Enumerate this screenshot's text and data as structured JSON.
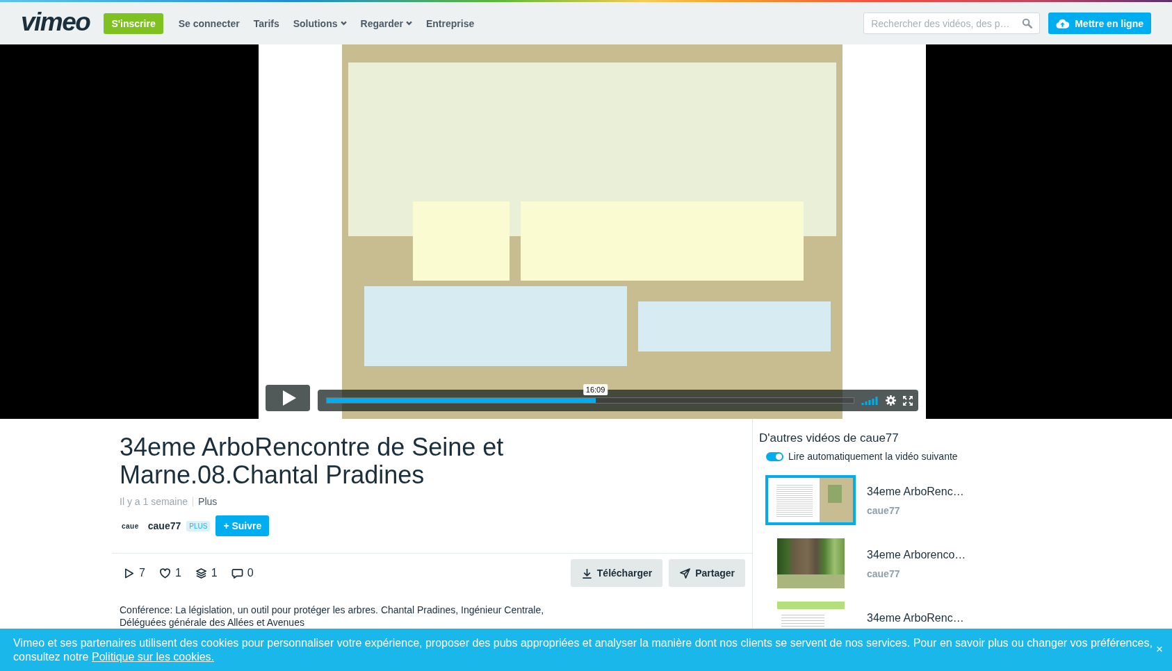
{
  "header": {
    "logo": "vimeo",
    "signup_button": "S'inscrire",
    "nav": [
      {
        "label": "Se connecter",
        "dropdown": false
      },
      {
        "label": "Tarifs",
        "dropdown": false
      },
      {
        "label": "Solutions",
        "dropdown": true
      },
      {
        "label": "Regarder",
        "dropdown": true
      },
      {
        "label": "Entreprise",
        "dropdown": false
      }
    ],
    "search": {
      "placeholder": "Rechercher des vidéos, des p…"
    },
    "upload_button": "Mettre en ligne"
  },
  "player": {
    "playing": false,
    "progress": {
      "level": 0.51
    },
    "time_tooltip": "16:09"
  },
  "video": {
    "title": "34eme ArboRencontre de Seine et Marne.08.Chantal Pradines",
    "age": "Il y a 1 semaine",
    "more_link": "Plus",
    "channel": {
      "logo": "caue",
      "name": "caue77",
      "badge": "PLUS",
      "follow_button": "+ Suivre"
    },
    "stats": [
      {
        "kind": "plays",
        "value": "7"
      },
      {
        "kind": "likes",
        "value": "1"
      },
      {
        "kind": "collections",
        "value": "1"
      },
      {
        "kind": "comments",
        "value": "0"
      }
    ],
    "actions": [
      {
        "kind": "download",
        "label": "Télécharger"
      },
      {
        "kind": "share",
        "label": "Partager"
      }
    ],
    "description": "Conférence: La législation, un outil pour protéger les arbres. Chantal Pradines, Ingénieur Centrale, Déléguées générale des Allées et Avenues"
  },
  "sidebar": {
    "heading": "D'autres vidéos de caue77",
    "autoplay": {
      "label": "Lire automatiquement la vidéo suivante",
      "on": true
    },
    "videos": [
      {
        "kind": "document",
        "title": "34eme ArboRenc…",
        "channel": "caue77",
        "selected": true
      },
      {
        "kind": "photo",
        "title": "34eme Arborenco…",
        "channel": "caue77",
        "selected": false
      },
      {
        "kind": "slide",
        "title": "34eme ArboRenc…",
        "selected": false
      }
    ]
  },
  "cookie_banner": {
    "text": "Vimeo et ses partenaires utilisent des cookies pour personnaliser votre expérience, proposer des pubs appropriées et analyser la manière dont nos clients se servent de nos services. Pour en savoir plus ou changer vos préférences, consultez notre",
    "link": "Politique sur les cookies.",
    "close": "×"
  }
}
